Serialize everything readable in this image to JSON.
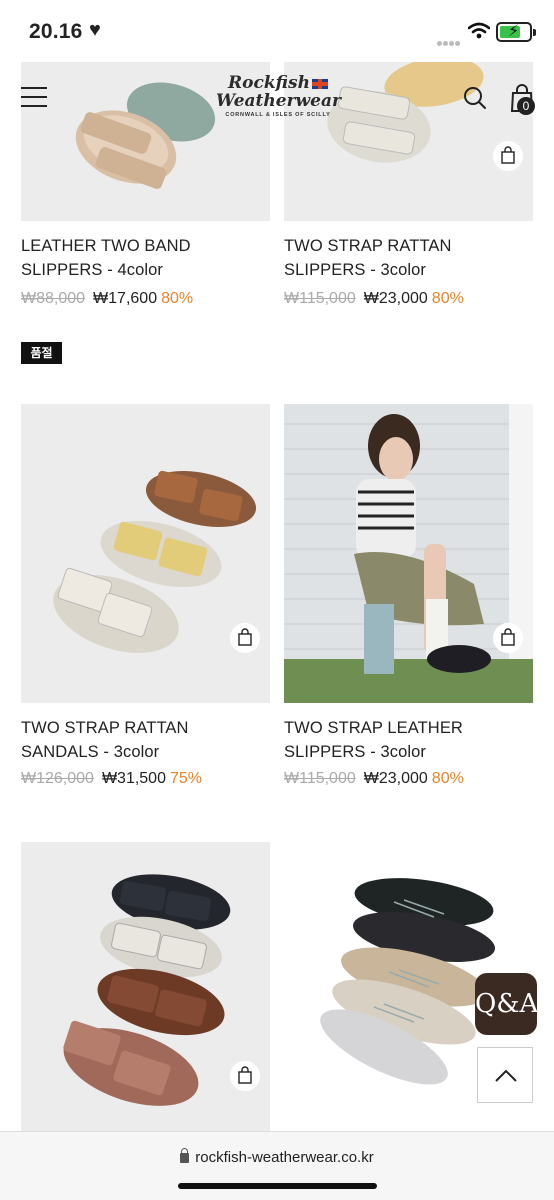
{
  "status_bar": {
    "time": "20.16",
    "heart": "♥"
  },
  "header": {
    "logo_line1": "Rockfish",
    "logo_line2": "Weatherwear",
    "logo_sub": "CORNWALL & ISLES OF SCILLY",
    "cart_count": "0"
  },
  "soldout_label": "품절",
  "products": [
    {
      "name1": "LEATHER TWO BAND",
      "name2": "SLIPPERS - 4color",
      "orig": "₩88,000",
      "sale": "₩17,600",
      "pct": "80%"
    },
    {
      "name1": "TWO STRAP RATTAN",
      "name2": "SLIPPERS - 3color",
      "orig": "₩115,000",
      "sale": "₩23,000",
      "pct": "80%"
    },
    {
      "name1": "TWO STRAP RATTAN",
      "name2": "SANDALS - 3color",
      "orig": "₩126,000",
      "sale": "₩31,500",
      "pct": "75%"
    },
    {
      "name1": "TWO STRAP LEATHER",
      "name2": "SLIPPERS - 3color",
      "orig": "₩115,000",
      "sale": "₩23,000",
      "pct": "80%"
    }
  ],
  "floating": {
    "qa_label": "Q&A"
  },
  "address_bar": {
    "url": "rockfish-weatherwear.co.kr"
  },
  "icons": [
    "menu-icon",
    "search-icon",
    "bag-icon",
    "lock-icon",
    "chevron-up-icon",
    "wifi-icon",
    "battery-icon"
  ],
  "colors": {
    "accent": "#e6832b",
    "qa_bg": "#3a2a22"
  }
}
